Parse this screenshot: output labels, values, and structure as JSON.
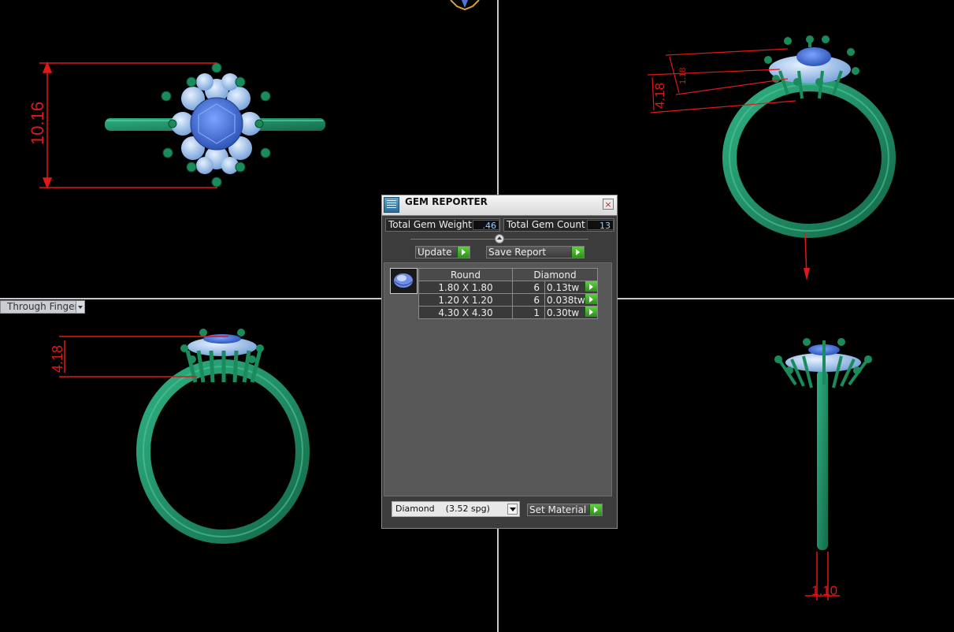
{
  "viewport": {
    "label": "Through Finger",
    "dimensions": {
      "top_view_height": "10.16",
      "right_view_upper": "1.18",
      "right_view_lower": "4.18",
      "front_view_height": "4.18",
      "side_view_width": "1.10"
    }
  },
  "gem_reporter": {
    "title": "GEM REPORTER",
    "close": "×",
    "total_weight_label": "Total Gem Weight",
    "total_weight_value": ".46",
    "total_count_label": "Total Gem Count",
    "total_count_value": "13",
    "update_label": "Update",
    "save_report_label": "Save Report",
    "table": {
      "headers": [
        "Round",
        "Diamond"
      ],
      "rows": [
        {
          "size": "1.80 X 1.80",
          "count": "6",
          "weight": "0.13tw"
        },
        {
          "size": "1.20 X 1.20",
          "count": "6",
          "weight": "0.038tw"
        },
        {
          "size": "4.30 X 4.30",
          "count": "1",
          "weight": "0.30tw"
        }
      ]
    },
    "material_select": "Diamond    (3.52 spg)",
    "set_material_label": "Set Material"
  },
  "colors": {
    "metal": "#1f8a62",
    "center_stone": "#4a78d8",
    "halo_stone": "#a8c8f0",
    "dimension": "#e01818",
    "go_button": "#3db528"
  },
  "icons": [
    "gem-reporter-icon",
    "close-icon",
    "slider-arrow-icon",
    "dropdown-arrow-icon",
    "go-arrow-icon",
    "round-gem-icon"
  ]
}
